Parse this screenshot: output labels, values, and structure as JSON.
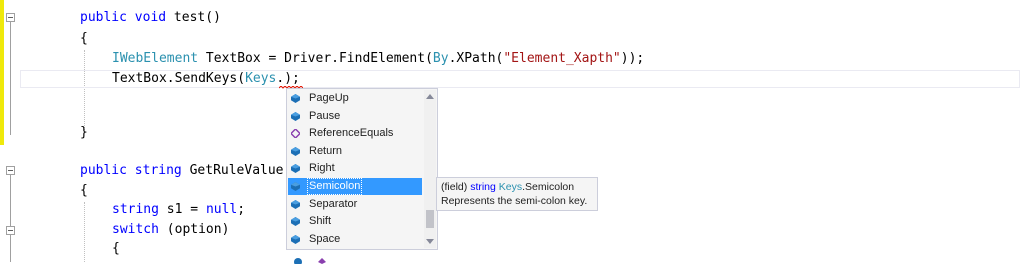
{
  "editor": {
    "lines": {
      "l1": {
        "kw1": "public",
        "kw2": "void",
        "rest": " test()"
      },
      "l2": {
        "text": "{"
      },
      "l3": {
        "type": "IWebElement",
        "mid": " TextBox = Driver.FindElement(",
        "type2": "By",
        "mid2": ".XPath(",
        "str": "\"Element_Xapth\"",
        "end": "));"
      },
      "l4": {
        "pre": "TextBox.SendKeys(",
        "type": "Keys",
        "post": ".);"
      },
      "l6": {
        "text": "}"
      },
      "l8": {
        "kw1": "public",
        "kw2": "string",
        "rest": " GetRuleValue"
      },
      "l9": {
        "text": "{"
      },
      "l10": {
        "kw": "string",
        "rest": " s1 = ",
        "kw2": "null",
        "end": ";"
      },
      "l11": {
        "kw": "switch",
        "rest": " (option)"
      },
      "l12": {
        "text": "{"
      }
    }
  },
  "completion": {
    "items": [
      {
        "label": "PageUp",
        "icon": "field-icon"
      },
      {
        "label": "Pause",
        "icon": "field-icon"
      },
      {
        "label": "ReferenceEquals",
        "icon": "method-icon"
      },
      {
        "label": "Return",
        "icon": "field-icon"
      },
      {
        "label": "Right",
        "icon": "field-icon"
      },
      {
        "label": "Semicolon",
        "icon": "field-icon",
        "selected": true
      },
      {
        "label": "Separator",
        "icon": "field-icon"
      },
      {
        "label": "Shift",
        "icon": "field-icon"
      },
      {
        "label": "Space",
        "icon": "field-icon"
      }
    ]
  },
  "tooltip": {
    "prefix": "(field) ",
    "type_kw": "string",
    "space": " ",
    "class": "Keys",
    "member": ".Semicolon",
    "description": "Represents the semi-colon key."
  },
  "colors": {
    "keyword": "#0000ff",
    "type": "#2b91af",
    "string": "#a31515",
    "selection": "#3399ff",
    "field_icon": "#1c6fb5",
    "method_icon": "#8a3fae"
  }
}
